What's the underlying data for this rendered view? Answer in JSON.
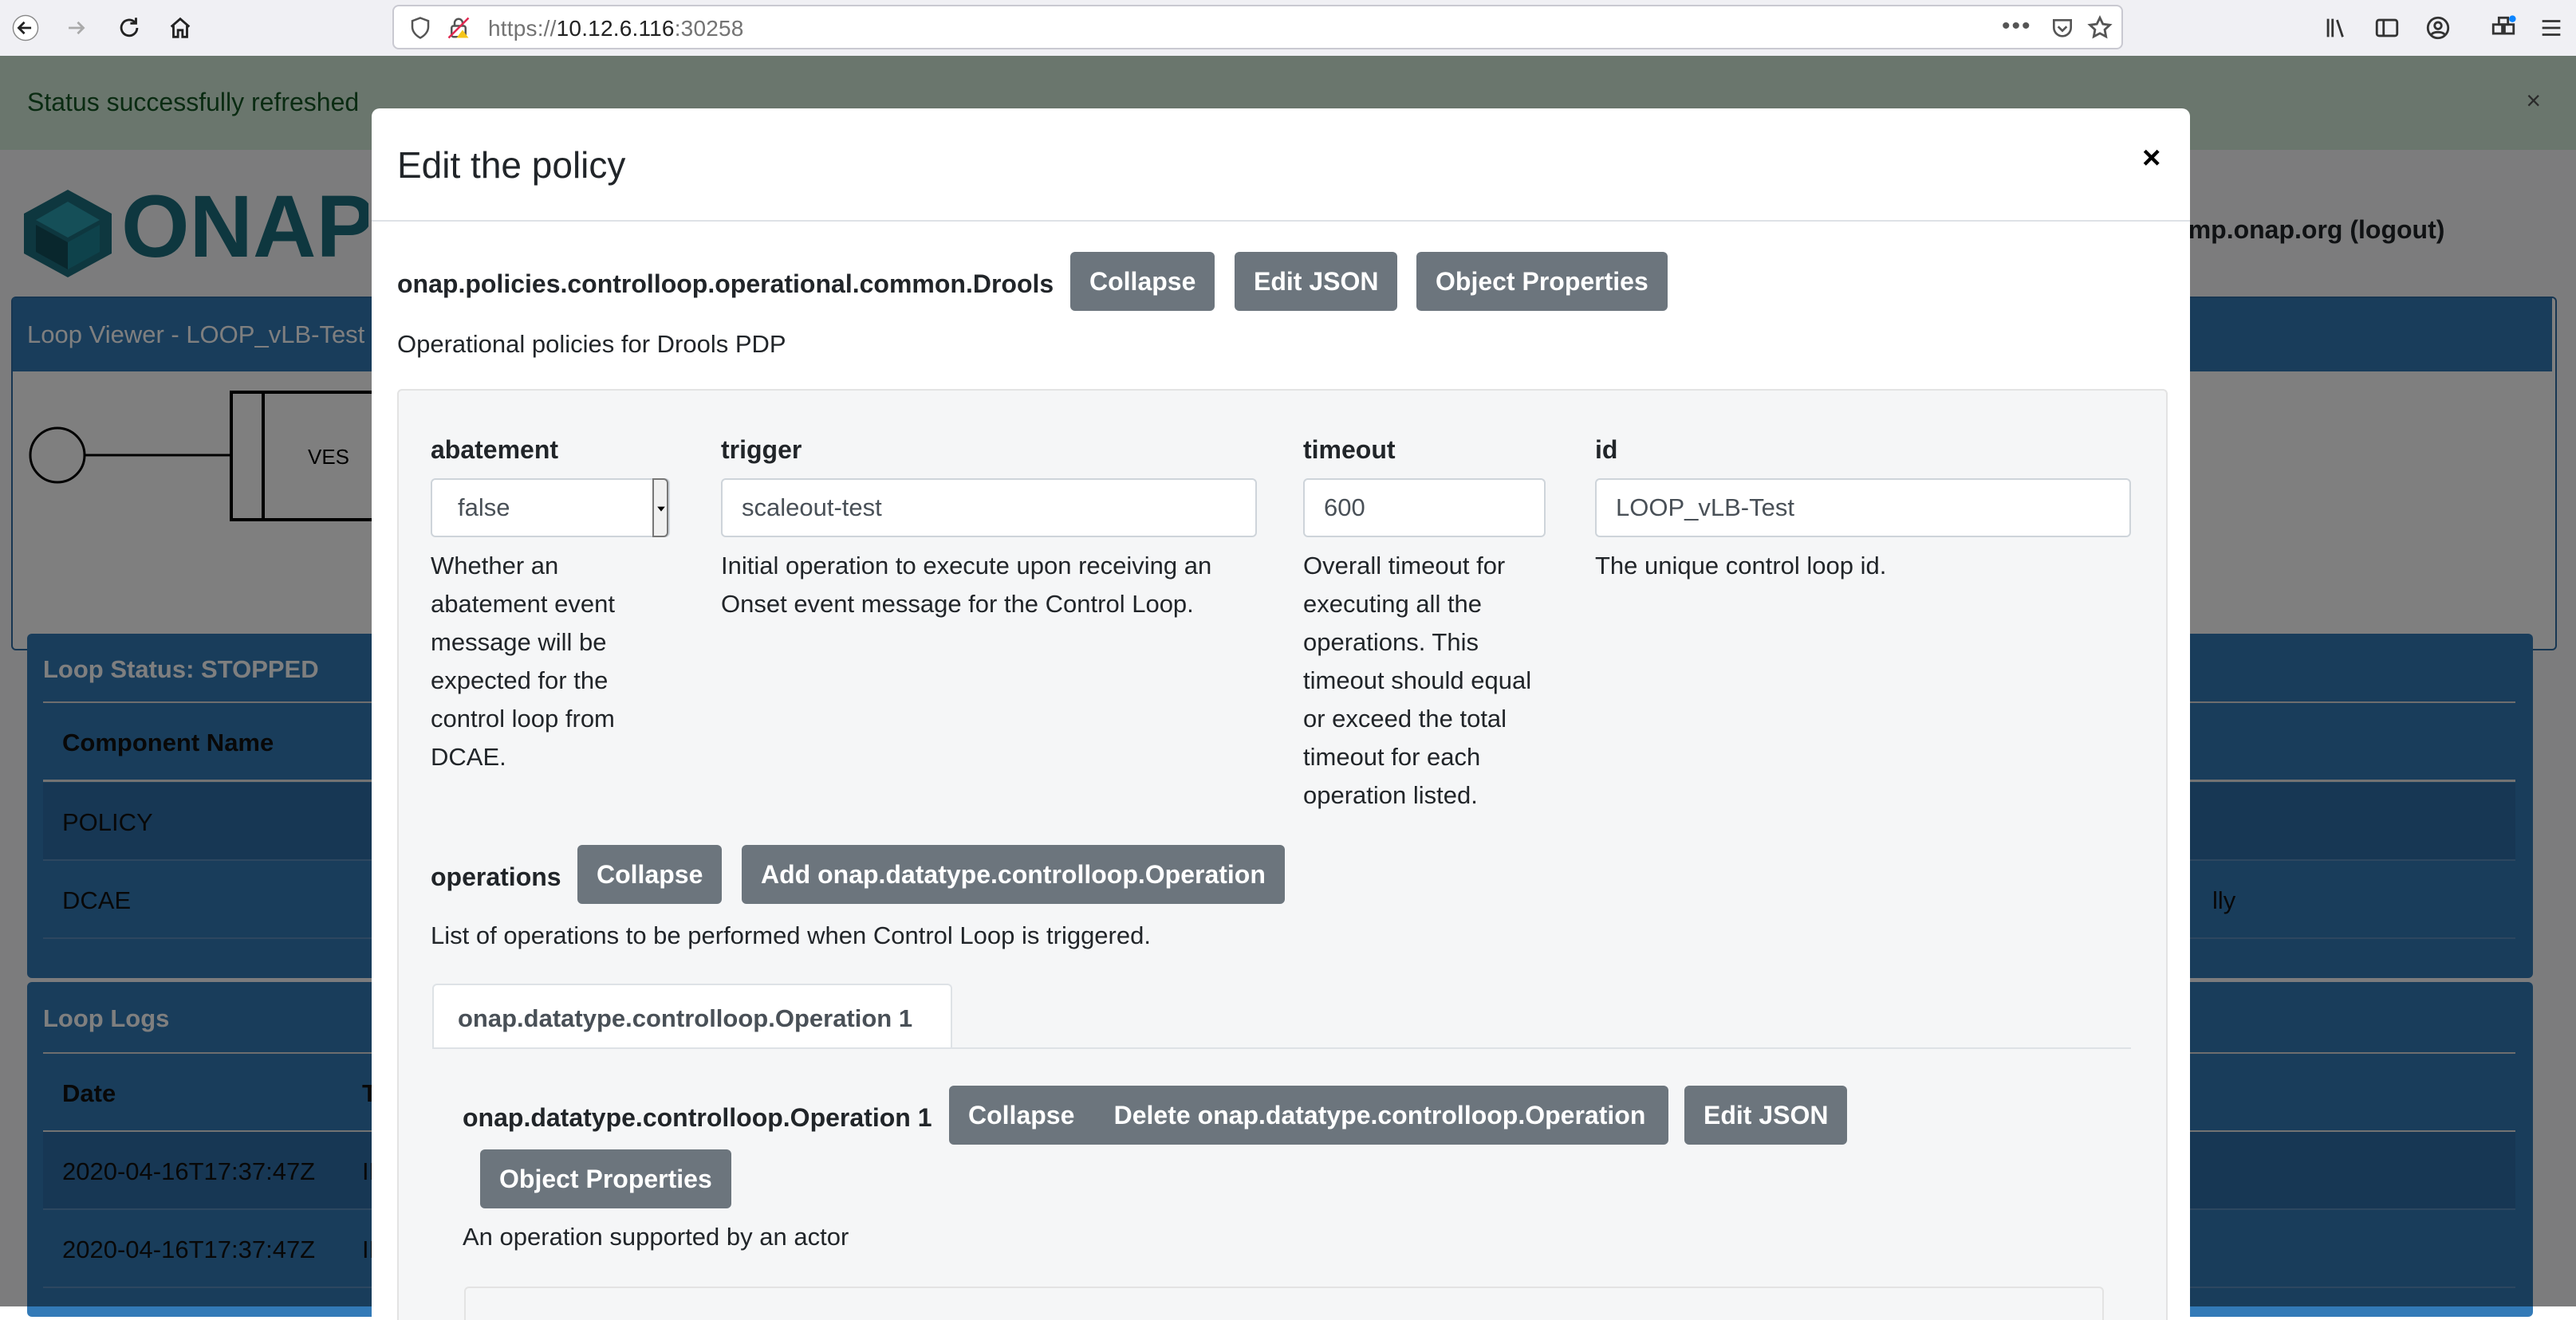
{
  "browser": {
    "url_prefix": "https://",
    "url_host": "10.12.6.116",
    "url_port": ":30258"
  },
  "alert": {
    "message": "Status successfully refreshed",
    "close": "×"
  },
  "header": {
    "user": "mp@clamp.onap.org (logout)"
  },
  "loop_viewer": {
    "title": "Loop Viewer - LOOP_vLB-Test",
    "node_label": "VES"
  },
  "loop_status": {
    "title": "Loop Status: STOPPED",
    "column_header": "Component Name",
    "rows": [
      "POLICY",
      "DCAE"
    ],
    "partial_text": "lly"
  },
  "loop_logs": {
    "title": "Loop Logs",
    "columns": [
      "Date",
      "T"
    ],
    "rows": [
      {
        "date": "2020-04-16T17:37:47Z",
        "type": "IN"
      },
      {
        "date": "2020-04-16T17:37:47Z",
        "type": "IN"
      }
    ]
  },
  "modal": {
    "title": "Edit the policy",
    "close": "×",
    "policy_type": "onap.policies.controlloop.operational.common.Drools",
    "buttons": {
      "collapse": "Collapse",
      "edit_json": "Edit JSON",
      "object_properties": "Object Properties"
    },
    "policy_description": "Operational policies for Drools PDP",
    "fields": {
      "abatement": {
        "label": "abatement",
        "value": "false",
        "description": "Whether an abatement event message will be expected for the control loop from DCAE."
      },
      "trigger": {
        "label": "trigger",
        "value": "scaleout-test",
        "description": "Initial operation to execute upon receiving an Onset event message for the Control Loop."
      },
      "timeout": {
        "label": "timeout",
        "value": "600",
        "description": "Overall timeout for executing all the operations. This timeout should equal or exceed the total timeout for each operation listed."
      },
      "id": {
        "label": "id",
        "value": "LOOP_vLB-Test",
        "description": "The unique control loop id."
      }
    },
    "operations": {
      "label": "operations",
      "collapse": "Collapse",
      "add": "Add onap.datatype.controlloop.Operation",
      "description": "List of operations to be performed when Control Loop is triggered.",
      "tab_label": "onap.datatype.controlloop.Operation 1",
      "item": {
        "title": "onap.datatype.controlloop.Operation 1",
        "collapse": "Collapse",
        "delete": "Delete onap.datatype.controlloop.Operation",
        "edit_json": "Edit JSON",
        "object_properties": "Object Properties",
        "description": "An operation supported by an actor"
      }
    }
  }
}
